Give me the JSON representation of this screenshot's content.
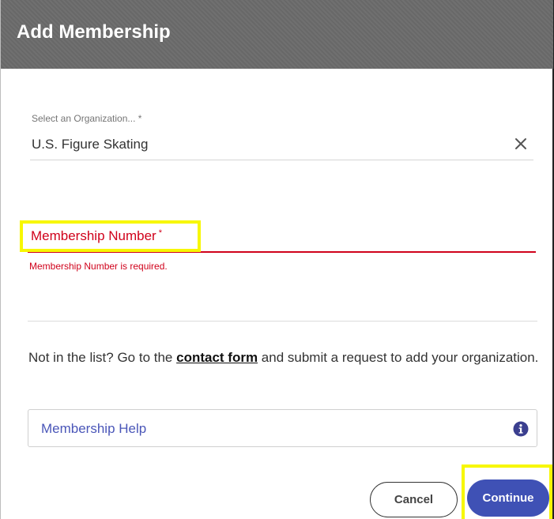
{
  "dialog": {
    "title": "Add Membership"
  },
  "organization": {
    "label": "Select an Organization... *",
    "value": "U.S. Figure Skating",
    "clear_icon": "close-icon"
  },
  "membership_number": {
    "label": "Membership Number",
    "required_mark": "*",
    "error": "Membership Number is required."
  },
  "info": {
    "text_before": "Not in the list? Go to the ",
    "link": "contact form",
    "text_after": " and submit a request to add your organization."
  },
  "help": {
    "label": "Membership Help",
    "icon": "info-icon"
  },
  "actions": {
    "cancel": "Cancel",
    "continue": "Continue"
  },
  "colors": {
    "header_bg": "#6b6b6b",
    "error": "#d0021b",
    "primary": "#3f51b5",
    "link": "#4a56b8",
    "highlight": "#f7f700"
  }
}
